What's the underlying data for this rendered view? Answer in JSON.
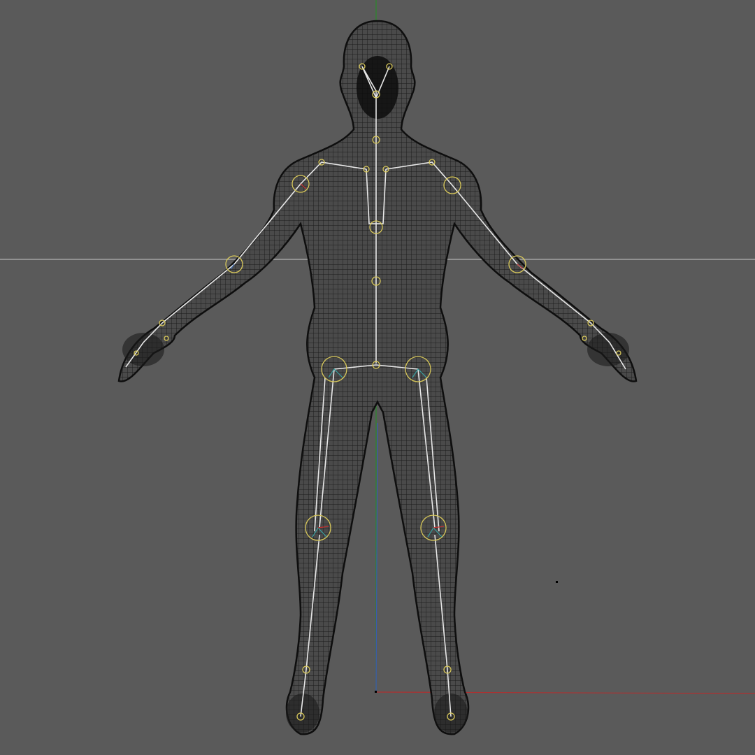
{
  "viewport": {
    "view": "front",
    "background_color": "#5a5a5a",
    "mesh_wire_color": "#1c1c1c",
    "bone_color": "#e8e8e8",
    "joint_color": "#d8c85a",
    "axis_colors": {
      "x": "#b03030",
      "y": "#2a8a2a",
      "z": "#3a5ab0"
    },
    "grid_axis_color": "#c8c8c8",
    "model": "character-mesh-wireframe",
    "rig": "skeleton-armature"
  }
}
